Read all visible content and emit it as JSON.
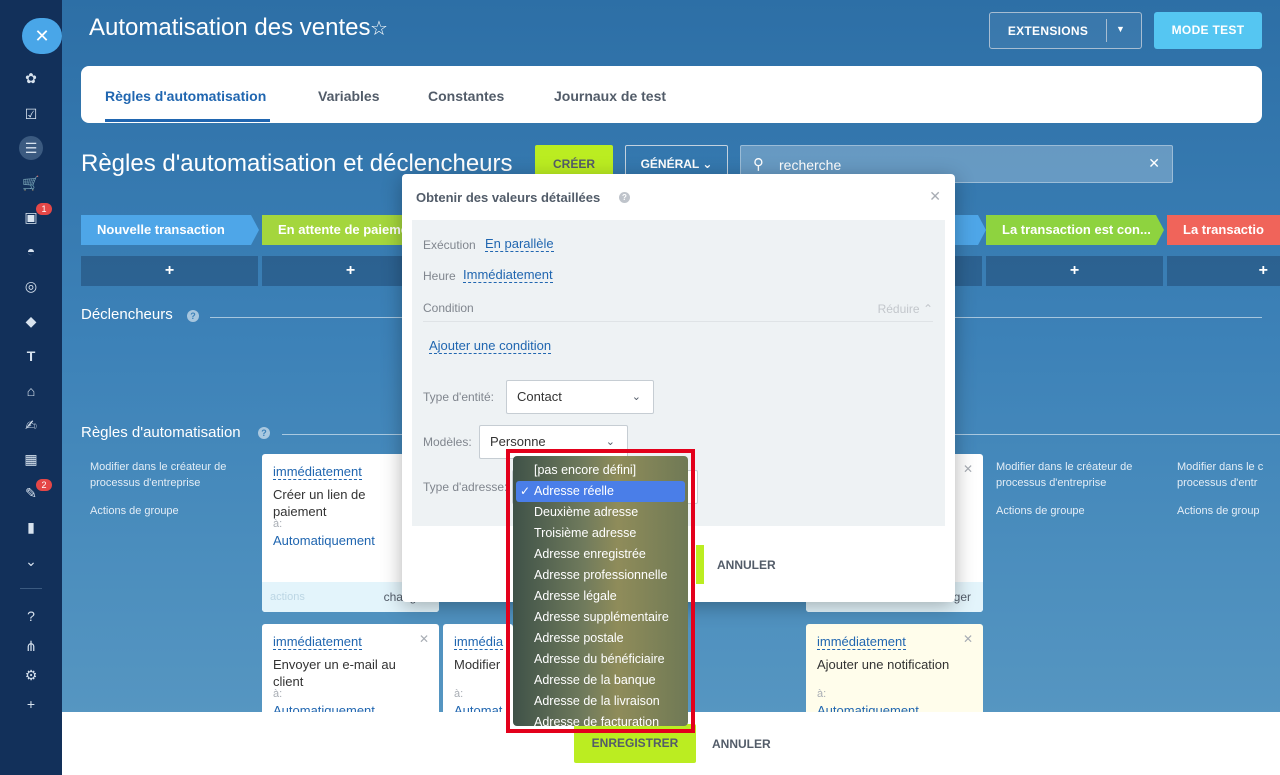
{
  "header": {
    "title": "Automatisation des ventes",
    "extensions_label": "EXTENSIONS",
    "test_mode_label": "MODE TEST"
  },
  "tabs": [
    {
      "label": "Règles d'automatisation",
      "active": true
    },
    {
      "label": "Variables"
    },
    {
      "label": "Constantes"
    },
    {
      "label": "Journaux de test"
    }
  ],
  "section": {
    "title": "Règles d'automatisation et déclencheurs",
    "create_label": "CRÉER",
    "general_label": "GÉNÉRAL",
    "search_placeholder": "recherche"
  },
  "nav": {
    "badges": [
      "1",
      "2"
    ]
  },
  "stages": [
    {
      "label": "Nouvelle transaction",
      "color": "#4ea6e8"
    },
    {
      "label": "En attente de paieme",
      "color": "#a4d63d"
    },
    {
      "label": "La transaction est con...",
      "color": "#8ed33f"
    },
    {
      "label": "La transactio",
      "color": "#f0645a"
    }
  ],
  "triggers_heading": "Déclencheurs",
  "rules_heading": "Règles d'automatisation",
  "column_notes": {
    "designer": "Modifier dans le créateur de processus d'entreprise",
    "designer_short": "Modifier dans le c processus d'entr",
    "group": "Actions de groupe",
    "group_short": "Actions de group"
  },
  "cards": {
    "when": "immédiatement",
    "when_short": "immédia",
    "a_label": "à:",
    "auto": "Automatiquement",
    "auto_short": "Automat",
    "card1_title": "Créer un lien de paiement",
    "card2_title": "Envoyer un e-mail au client",
    "card3_title": "Modifier",
    "card4_title": "Ajouter une notification",
    "foot_actions": "actions",
    "foot_change": "changer"
  },
  "modal": {
    "title": "Obtenir des valeurs détaillées",
    "execution_label": "Exécution",
    "execution_value": "En parallèle",
    "time_label": "Heure",
    "time_value": "Immédiatement",
    "condition_label": "Condition",
    "reduce_label": "Réduire",
    "add_condition": "Ajouter une condition",
    "entity_type_label": "Type d'entité:",
    "entity_type_value": "Contact",
    "models_label": "Modèles:",
    "models_value": "Personne",
    "address_type_label": "Type d'adresse:",
    "cancel_label": "ANNULER"
  },
  "address_options": [
    "[pas encore défini]",
    "Adresse réelle",
    "Deuxième adresse",
    "Troisième adresse",
    "Adresse enregistrée",
    "Adresse professionnelle",
    "Adresse légale",
    "Adresse supplémentaire",
    "Adresse postale",
    "Adresse du bénéficiaire",
    "Adresse de la banque",
    "Adresse de la livraison",
    "Adresse de facturation"
  ],
  "address_selected": "Adresse réelle",
  "footer": {
    "save_label": "ENREGISTRER",
    "cancel_label": "ANNULER"
  },
  "colors": {
    "accent_green": "#bbed21",
    "highlight_red": "#e3001b",
    "selection_blue": "#4a7ee8"
  }
}
